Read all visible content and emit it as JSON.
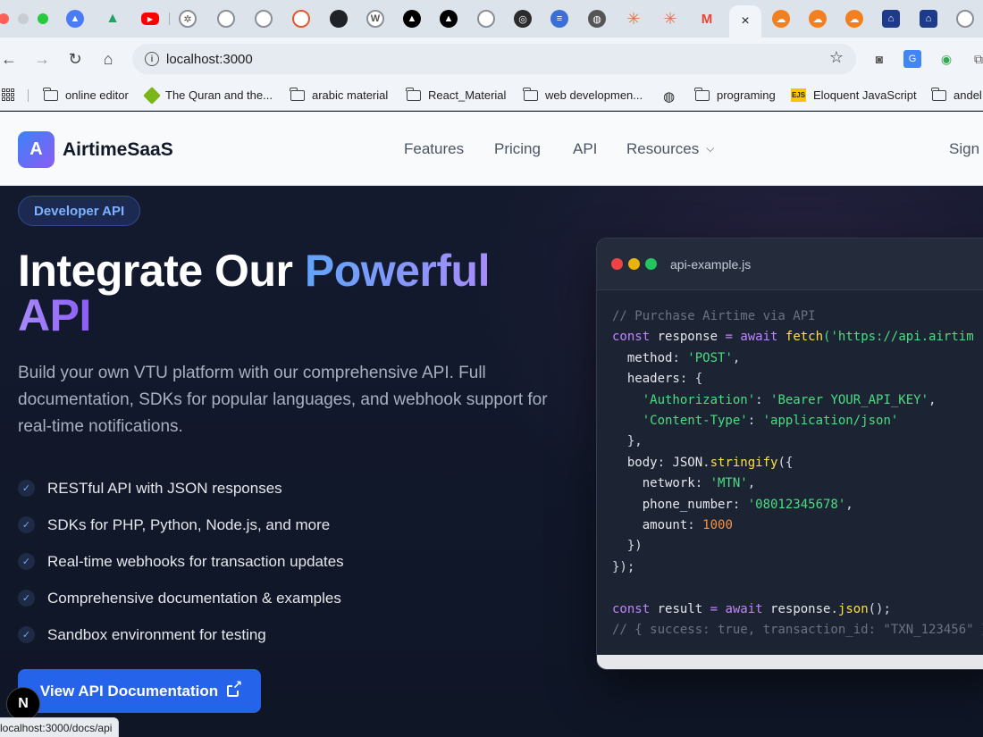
{
  "browser": {
    "active_tab_close": "×",
    "url": "localhost:3000",
    "bookmarks": [
      "online editor",
      "The Quran and the...",
      "arabic material",
      "React_Material",
      "web  developmen...",
      "programing",
      "Eloquent JavaScript",
      "andel"
    ],
    "status_url": "localhost:3000/docs/api"
  },
  "site": {
    "logo_letter": "A",
    "brand": "AirtimeSaaS",
    "nav": [
      "Features",
      "Pricing",
      "API",
      "Resources"
    ],
    "sign_in": "Sign"
  },
  "hero": {
    "badge": "Developer API",
    "headline_part1": "Integrate Our ",
    "headline_highlight": "Powerful",
    "headline_part2": "API",
    "lead": "Build your own VTU platform with our comprehensive API. Full documentation, SDKs for popular languages, and webhook support for real-time notifications.",
    "features": [
      "RESTful API with JSON responses",
      "SDKs for PHP, Python, Node.js, and more",
      "Real-time webhooks for transaction updates",
      "Comprehensive documentation & examples",
      "Sandbox environment for testing"
    ],
    "cta": "View API Documentation"
  },
  "code": {
    "filename": "api-example.js",
    "l1": "// Purchase Airtime via API",
    "l2_kw": "const",
    "l2_var": " response ",
    "l2_eq": "= ",
    "l2_await": "await",
    "l2_fn": " fetch",
    "l2_str": "('https://api.airtim",
    "l3_prop": "  method",
    "l3_str": "'POST'",
    "l4_prop": "  headers",
    "l5_key": "'Authorization'",
    "l5_val": "'Bearer YOUR_API_KEY'",
    "l6_key": "'Content-Type'",
    "l6_val": "'application/json'",
    "l7": "  },",
    "l8_prop": "  body",
    "l8_obj": "JSON",
    "l8_fn": "stringify",
    "l9_prop": "    network",
    "l9_str": "'MTN'",
    "l10_prop": "    phone_number",
    "l10_str": "'08012345678'",
    "l11_prop": "    amount",
    "l11_num": "1000",
    "l12": "  })",
    "l13": "});",
    "l15_kw": "const",
    "l15_var": " result ",
    "l15_await": "await",
    "l15_obj": " response",
    "l15_fn": "json",
    "l16": "// { success: true, transaction_id: \"TXN_123456\" }"
  },
  "next_badge": "N"
}
